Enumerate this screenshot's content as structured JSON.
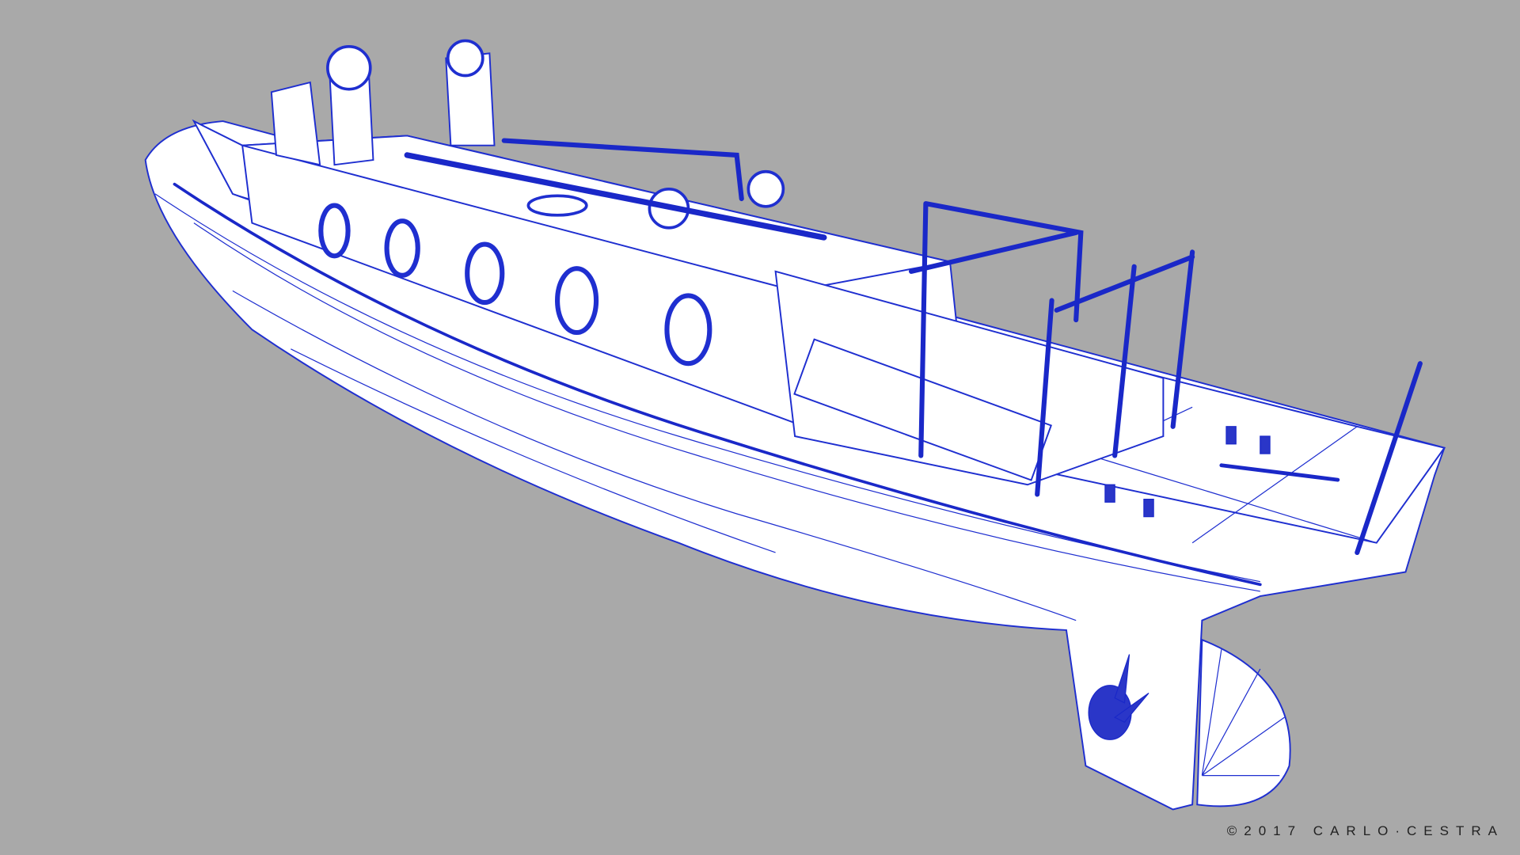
{
  "render": {
    "subject": "boat-wireframe",
    "wire_color": "#1f2fd0",
    "background_color": "#a9a9a9"
  },
  "credit": {
    "text": "©2017 CARLO·CESTRA"
  }
}
